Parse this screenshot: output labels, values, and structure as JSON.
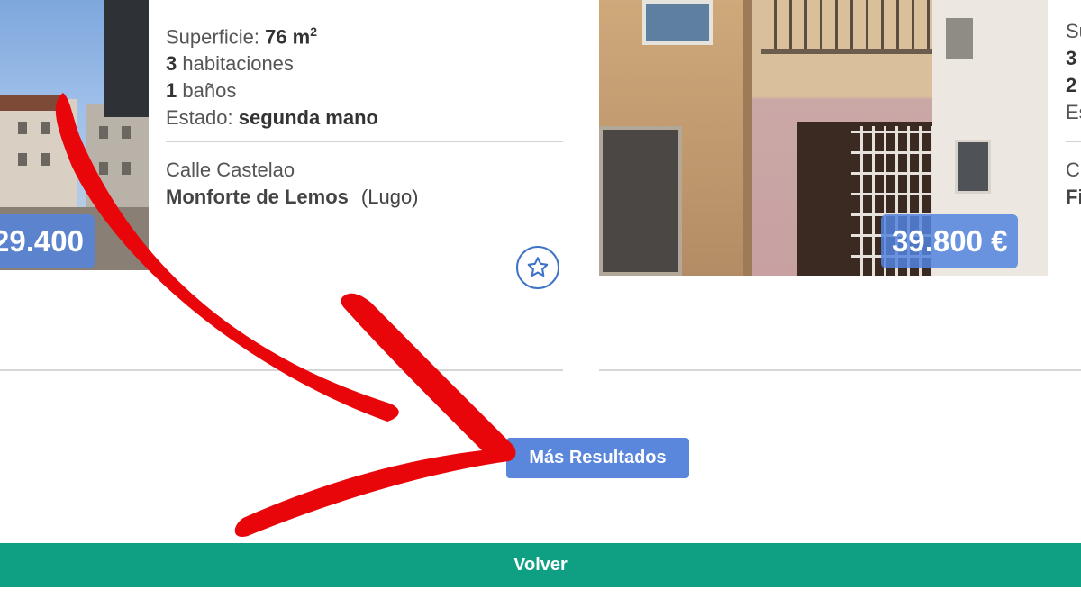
{
  "listings": [
    {
      "price": "29.400",
      "superficie_label": "Superficie:",
      "superficie_value": "76 m",
      "superficie_sup": "2",
      "rooms_num": "3",
      "rooms_label": "habitaciones",
      "baths_num": "1",
      "baths_label": "baños",
      "estado_label": "Estado:",
      "estado_value": "segunda mano",
      "street": "Calle Castelao",
      "city": "Monforte de Lemos",
      "province": "(Lugo)"
    },
    {
      "price": "39.800 €"
    },
    {
      "line1": "Su",
      "line2": "3",
      "line3": "2",
      "line4": "Es",
      "street": "C",
      "city": "Fi"
    }
  ],
  "buttons": {
    "more_results": "Más Resultados",
    "back": "Volver"
  },
  "colors": {
    "price_tag": "#5484de",
    "more_button": "#5a86dc",
    "back_bar": "#0fa083",
    "favorite": "#3e73c9",
    "annotation_arrow": "#e8060b"
  },
  "icons": {
    "favorite": "star-icon"
  }
}
